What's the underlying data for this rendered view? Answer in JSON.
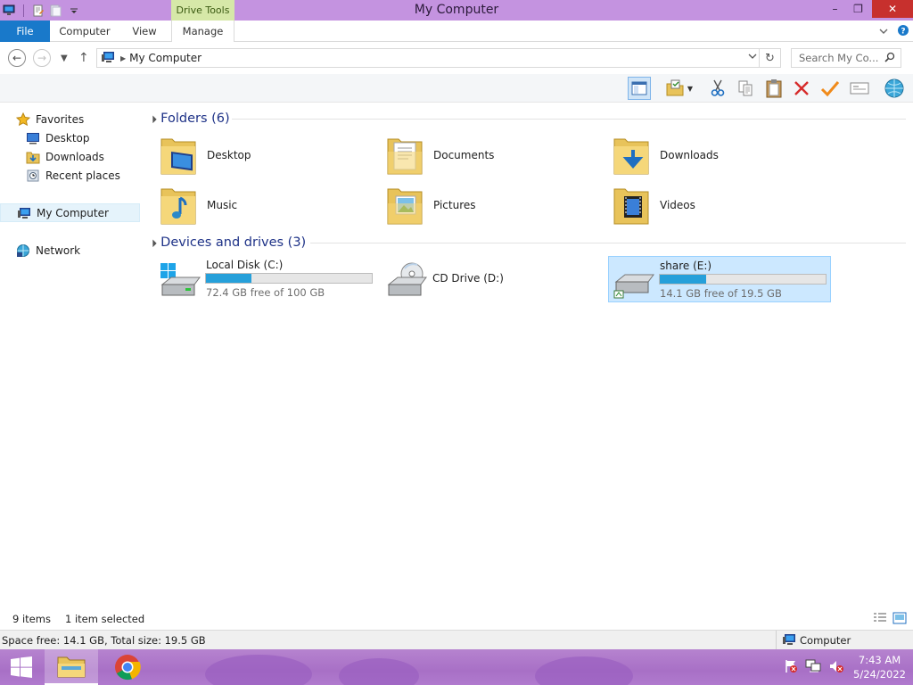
{
  "window": {
    "title": "My Computer",
    "contextual_tab_group": "Drive Tools",
    "minimize": "–",
    "maximize": "❐",
    "close": "✕"
  },
  "ribbon": {
    "tabs": [
      {
        "label": "File"
      },
      {
        "label": "Computer"
      },
      {
        "label": "View"
      },
      {
        "label": "Manage"
      }
    ]
  },
  "address": {
    "path": "My Computer",
    "search_placeholder": "Search My Co..."
  },
  "nav": {
    "favorites": "Favorites",
    "desktop": "Desktop",
    "downloads": "Downloads",
    "recent": "Recent places",
    "computer": "My Computer",
    "network": "Network"
  },
  "content": {
    "folders_header": "Folders (6)",
    "folders": [
      {
        "label": "Desktop",
        "icon": "desktop-folder-icon"
      },
      {
        "label": "Documents",
        "icon": "documents-folder-icon"
      },
      {
        "label": "Downloads",
        "icon": "downloads-folder-icon"
      },
      {
        "label": "Music",
        "icon": "music-folder-icon"
      },
      {
        "label": "Pictures",
        "icon": "pictures-folder-icon"
      },
      {
        "label": "Videos",
        "icon": "videos-folder-icon"
      }
    ],
    "devices_header": "Devices and drives (3)",
    "drives": [
      {
        "label": "Local Disk (C:)",
        "free": "72.4 GB free of 100 GB",
        "used_fraction": 0.276,
        "selected": false
      },
      {
        "label": "CD Drive (D:)",
        "free": "",
        "used_fraction": null,
        "selected": false
      },
      {
        "label": "share (E:)",
        "free": "14.1 GB free of 19.5 GB",
        "used_fraction": 0.277,
        "selected": true
      }
    ]
  },
  "status": {
    "items": "9 items",
    "selected": "1 item selected",
    "details": "Space free: 14.1 GB, Total size: 19.5 GB",
    "location": "Computer"
  },
  "taskbar": {
    "time": "7:43 AM",
    "date": "5/24/2022"
  },
  "colors": {
    "titlebar": "#c493e0",
    "file_tab": "#1979ca",
    "drive_bar": "#26a0da",
    "selection": "#cce8ff"
  }
}
